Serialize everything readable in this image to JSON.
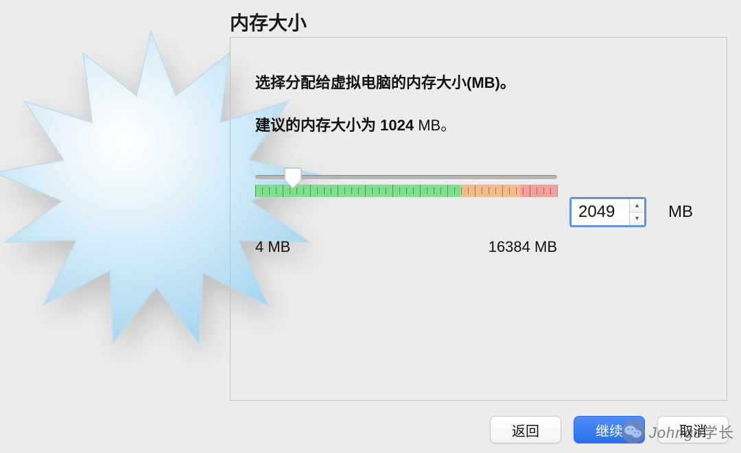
{
  "title": "内存大小",
  "panel": {
    "desc": "选择分配给虚拟电脑的内存大小(MB)。",
    "recommend": {
      "prefix": "建议的内存大小为 ",
      "value": "1024",
      "suffix": " MB。"
    }
  },
  "slider": {
    "min_label": "4 MB",
    "max_label": "16384 MB",
    "value": 2049,
    "min": 4,
    "max": 16384,
    "thumb_position_percent": 12.5
  },
  "stepper": {
    "value": "2049",
    "unit": "MB"
  },
  "buttons": {
    "back": "返回",
    "continue": "继续",
    "cancel": "取消"
  },
  "watermark": {
    "text": "Johngo学长"
  }
}
